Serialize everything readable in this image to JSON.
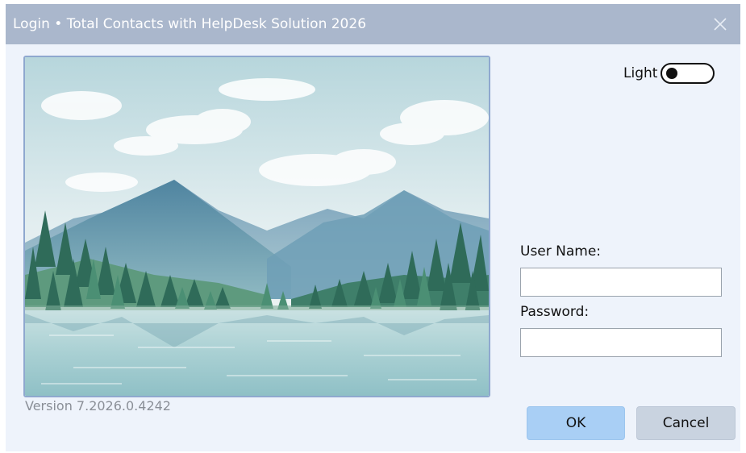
{
  "window": {
    "title": "Login • Total Contacts with HelpDesk Solution 2026",
    "close_icon": "close-icon"
  },
  "theme": {
    "label": "Light",
    "toggle_state": "off"
  },
  "form": {
    "username_label": "User Name:",
    "username_value": "",
    "password_label": "Password:",
    "password_value": ""
  },
  "buttons": {
    "ok_label": "OK",
    "cancel_label": "Cancel"
  },
  "footer": {
    "version": "Version 7.2026.0.4242"
  },
  "colors": {
    "titlebar": "#aab7cc",
    "background": "#eef3fb",
    "ok_button": "#a9cff5",
    "cancel_button": "#c9d3e0"
  }
}
